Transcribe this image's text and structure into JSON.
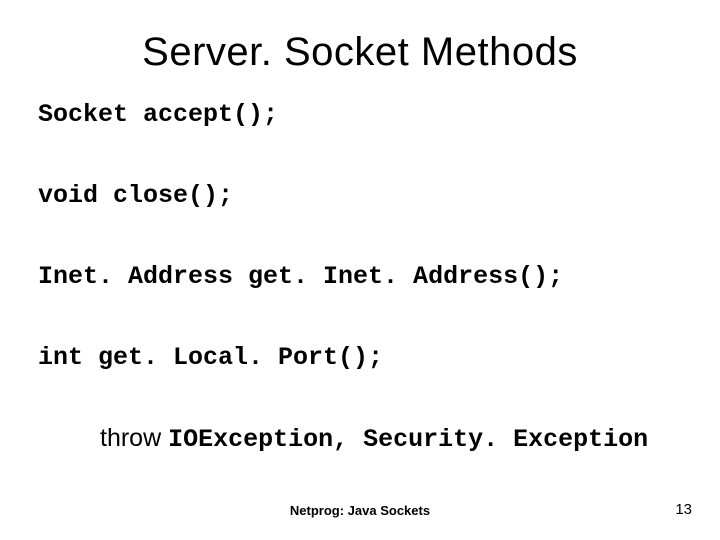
{
  "title": "Server. Socket Methods",
  "methods": [
    "Socket accept();",
    "void close();",
    "Inet. Address get. Inet. Address();",
    "int get. Local. Port();"
  ],
  "throw": {
    "word": "throw ",
    "code": "IOException, Security. Exception"
  },
  "footer": {
    "center": "Netprog: Java Sockets",
    "page": "13"
  }
}
